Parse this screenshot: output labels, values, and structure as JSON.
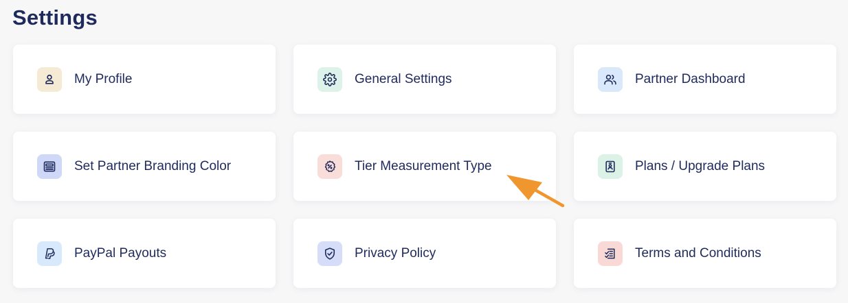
{
  "page": {
    "title": "Settings"
  },
  "colors": {
    "background": "#f7f7f8",
    "card": "#ffffff",
    "text": "#1f2a5c",
    "annotation": "#f0962f"
  },
  "cards": [
    {
      "label": "My Profile",
      "icon": "user-icon",
      "icon_bg": "#f5ead3"
    },
    {
      "label": "General Settings",
      "icon": "gear-icon",
      "icon_bg": "#ddf3ea"
    },
    {
      "label": "Partner Dashboard",
      "icon": "users-icon",
      "icon_bg": "#d9e8fb"
    },
    {
      "label": "Set Partner Branding Color",
      "icon": "branding-icon",
      "icon_bg": "#cfd8f7"
    },
    {
      "label": "Tier Measurement Type",
      "icon": "percent-badge-icon",
      "icon_bg": "#f9ddd8"
    },
    {
      "label": "Plans / Upgrade Plans",
      "icon": "id-badge-icon",
      "icon_bg": "#dcf2e6"
    },
    {
      "label": "PayPal Payouts",
      "icon": "paypal-icon",
      "icon_bg": "#d7e9fb"
    },
    {
      "label": "Privacy Policy",
      "icon": "shield-check-icon",
      "icon_bg": "#d5ddf8"
    },
    {
      "label": "Terms and Conditions",
      "icon": "document-list-icon",
      "icon_bg": "#f8d9d5"
    }
  ]
}
